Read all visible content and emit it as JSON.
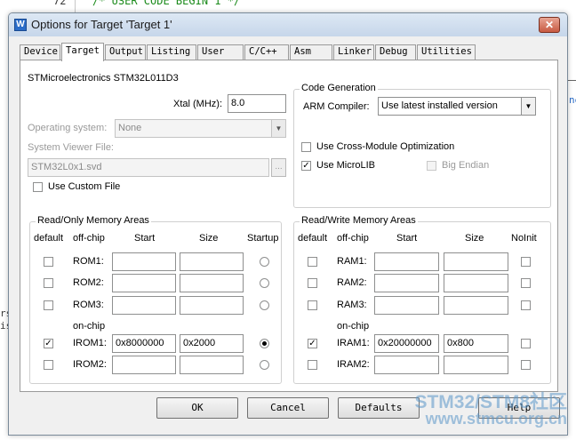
{
  "editor": {
    "line_number": "72",
    "code": "/* USER CODE BEGIN 1 */",
    "side_left_1": "rs",
    "side_left_2": "is",
    "side_right": "ne"
  },
  "dialog": {
    "title": "Options for Target 'Target 1'",
    "close_label": "✕",
    "tabs": [
      "Device",
      "Target",
      "Output",
      "Listing",
      "User",
      "C/C++",
      "Asm",
      "Linker",
      "Debug",
      "Utilities"
    ],
    "active_tab": "Target"
  },
  "target": {
    "device_name": "STMicroelectronics STM32L011D3",
    "xtal_label": "Xtal (MHz):",
    "xtal_value": "8.0",
    "os_label": "Operating system:",
    "os_value": "None",
    "svd_label": "System Viewer File:",
    "svd_value": "STM32L0x1.svd",
    "svd_browse": "...",
    "custom_file_label": "Use Custom File"
  },
  "code_generation": {
    "title": "Code Generation",
    "compiler_label": "ARM Compiler:",
    "compiler_value": "Use latest installed version",
    "cross_module_label": "Use Cross-Module Optimization",
    "microlib_label": "Use MicroLIB",
    "big_endian_label": "Big Endian",
    "cross_module_checked": false,
    "microlib_checked": true,
    "big_endian_checked": false
  },
  "readonly_memory": {
    "title": "Read/Only Memory Areas",
    "headers": {
      "default": "default",
      "offchip": "off-chip",
      "start": "Start",
      "size": "Size",
      "startup": "Startup"
    },
    "onchip_label": "on-chip",
    "rows": [
      {
        "label": "ROM1:",
        "start": "",
        "size": "",
        "default": false,
        "startup": false
      },
      {
        "label": "ROM2:",
        "start": "",
        "size": "",
        "default": false,
        "startup": false
      },
      {
        "label": "ROM3:",
        "start": "",
        "size": "",
        "default": false,
        "startup": false
      },
      {
        "label": "IROM1:",
        "start": "0x8000000",
        "size": "0x2000",
        "default": true,
        "startup": true
      },
      {
        "label": "IROM2:",
        "start": "",
        "size": "",
        "default": false,
        "startup": false
      }
    ]
  },
  "readwrite_memory": {
    "title": "Read/Write Memory Areas",
    "headers": {
      "default": "default",
      "offchip": "off-chip",
      "start": "Start",
      "size": "Size",
      "noinit": "NoInit"
    },
    "onchip_label": "on-chip",
    "rows": [
      {
        "label": "RAM1:",
        "start": "",
        "size": "",
        "default": false,
        "noinit": false
      },
      {
        "label": "RAM2:",
        "start": "",
        "size": "",
        "default": false,
        "noinit": false
      },
      {
        "label": "RAM3:",
        "start": "",
        "size": "",
        "default": false,
        "noinit": false
      },
      {
        "label": "IRAM1:",
        "start": "0x20000000",
        "size": "0x800",
        "default": true,
        "noinit": false
      },
      {
        "label": "IRAM2:",
        "start": "",
        "size": "",
        "default": false,
        "noinit": false
      }
    ]
  },
  "buttons": {
    "ok": "OK",
    "cancel": "Cancel",
    "defaults": "Defaults",
    "help": "Help"
  },
  "watermark": {
    "line1": "STM32/STM8社区",
    "line2": "www.stmcu.org.cn"
  },
  "colors": {
    "titlebar": "#c6d6ea",
    "dialog_bg": "#f0f0f0",
    "code_green": "#1a8a1a",
    "watermark": "#5a96c8"
  }
}
